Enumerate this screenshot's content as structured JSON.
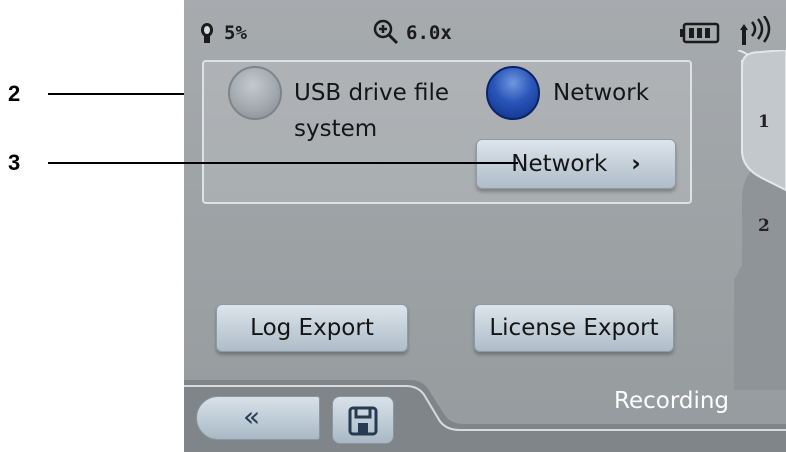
{
  "callouts": {
    "label_2": "2",
    "label_3": "3"
  },
  "status_bar": {
    "battery_text": "5%",
    "zoom_text": "6.0x",
    "icons": [
      "bulb-icon",
      "zoom-in-icon",
      "battery-icon",
      "signal-icon"
    ]
  },
  "storage_options": {
    "usb_label_line1": "USB drive file",
    "usb_label_line2": "system",
    "network_label": "Network",
    "selected": "Network"
  },
  "buttons": {
    "network_button": "Network",
    "log_export": "Log Export",
    "license_export": "License Export"
  },
  "tabs": {
    "tab1": "1",
    "tab2": "2"
  },
  "bottom_bar": {
    "recording": "Recording"
  },
  "colors": {
    "background": "#9ea3a6",
    "selected_radio": "#1e45a8",
    "button": "#c2ced8"
  }
}
